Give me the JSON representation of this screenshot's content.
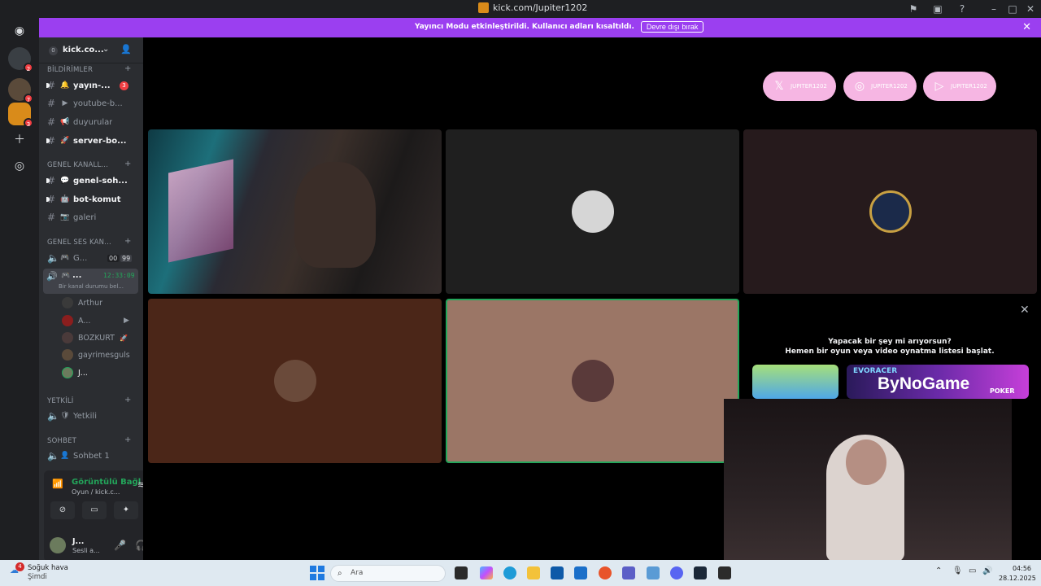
{
  "titlebar": {
    "url": "kick.com/Jupiter1202"
  },
  "banner": {
    "message": "Yayıncı Modu etkinleştirildi. Kullanıcı adları kısaltıldı.",
    "button": "Devre dışı bırak"
  },
  "server_rail": {
    "badges": [
      "2",
      "7",
      "3"
    ]
  },
  "server": {
    "zero": "0",
    "name": "kick.co..."
  },
  "categories": {
    "bildirimler": "BİLDİRİMLER",
    "genel_kanal": "GENEL KANALL...",
    "genel_ses": "GENEL SES KAN...",
    "yetkili": "YETKİLİ",
    "sohbet": "SOHBET"
  },
  "channels": {
    "yayin": {
      "label": "yayın-...",
      "badge": "3"
    },
    "youtube": {
      "label": "youtube-b..."
    },
    "duyurular": {
      "label": "duyurular"
    },
    "server_bo": {
      "label": "server-bo..."
    },
    "genel_soh": {
      "label": "genel-soh..."
    },
    "bot_komut": {
      "label": "bot-komut"
    },
    "galeri": {
      "label": "galeri"
    },
    "voice_g": {
      "label": "G...",
      "count_a": "00",
      "count_b": "99"
    },
    "voice_active": {
      "label": "...",
      "timer": "12:33:09",
      "status": "Bir kanal durumu bel..."
    },
    "yetkili": {
      "label": "Yetkili"
    },
    "sohbet1": {
      "label": "Sohbet 1"
    }
  },
  "voice_users": [
    "Arthur",
    "A...",
    "BOZKURT",
    "gayrimesguls",
    "J..."
  ],
  "voice_panel": {
    "title": "Görüntülü Bağl",
    "subtitle": "Oyun / kick.c..."
  },
  "user": {
    "name": "J...",
    "status": "Sesli a..."
  },
  "socials": [
    "JUPITER1202",
    "JUPITER1202",
    "JUPITER1202"
  ],
  "activity": {
    "line1": "Yapacak bir şey mi arıyorsun?",
    "line2": "Hemen bir oyun veya video oynatma listesi başlat.",
    "game2": "ByNoGame",
    "game2_tag": "EVORACER",
    "game3_tag": "POKER"
  },
  "taskbar": {
    "weather_badge": "4",
    "weather": "Soğuk hava",
    "weather_sub": "Şimdi",
    "search": "Ara",
    "time": "04:56",
    "date": "28.12.2025"
  },
  "colors": {
    "accent": "#9b3ff0",
    "voice_green": "#23a55a",
    "notify_red": "#f23f43",
    "social_pink": "#f6b6e3"
  }
}
